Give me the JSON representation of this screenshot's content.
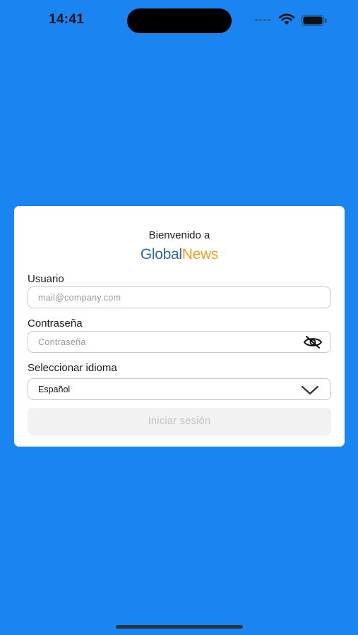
{
  "status_bar": {
    "time": "14:41"
  },
  "login_card": {
    "welcome_text": "Bienvenido a",
    "logo": {
      "part1": "Global",
      "part2": "News"
    },
    "username": {
      "label": "Usuario",
      "placeholder": "mail@company.com",
      "value": ""
    },
    "password": {
      "label": "Contraseña",
      "placeholder": "Contraseña",
      "value": "",
      "toggle_icon": "eye-slash-icon"
    },
    "language": {
      "label": "Seleccionar idioma",
      "selected": "Español",
      "icon": "chevron-down-icon"
    },
    "submit_label": "Iniciar sesión",
    "submit_enabled": false
  },
  "colors": {
    "background": "#1a84f0",
    "logo_blue": "#2f6aa8",
    "logo_orange": "#f0a020",
    "button_disabled_bg": "#f2f2f2",
    "button_disabled_text": "#c2c2c2"
  }
}
